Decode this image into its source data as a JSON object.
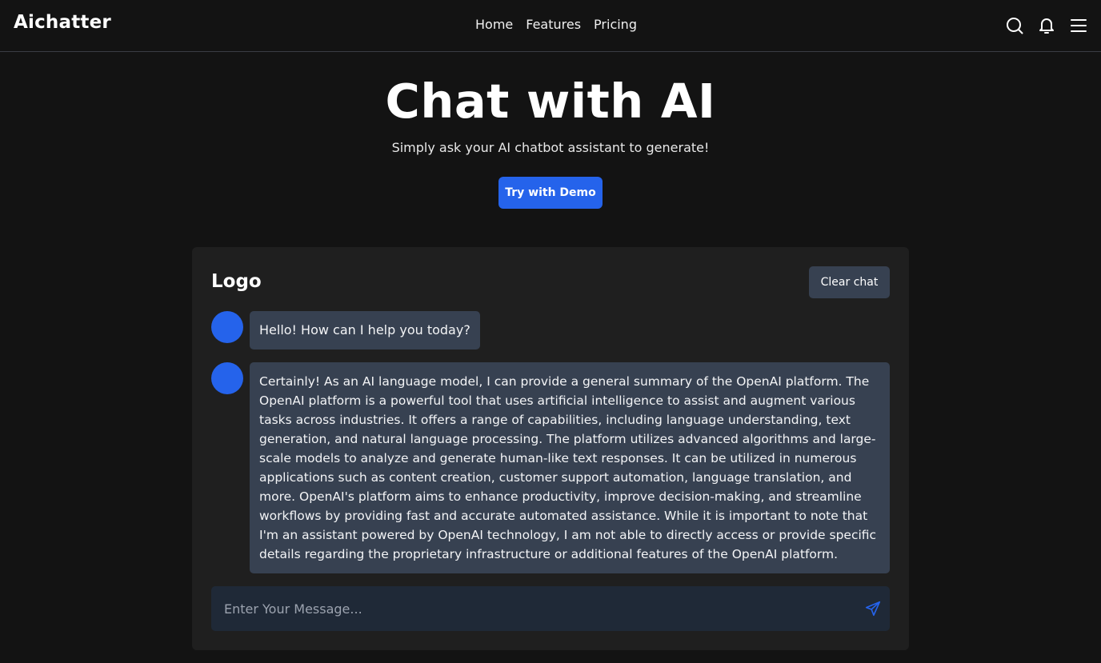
{
  "header": {
    "brand": "Aichatter",
    "nav": [
      "Home",
      "Features",
      "Pricing"
    ],
    "icons": [
      "search-icon",
      "bell-icon",
      "menu-icon"
    ]
  },
  "hero": {
    "title": "Chat with AI",
    "subtitle": "Simply ask your AI chatbot assistant to generate!",
    "cta_label": "Try with Demo"
  },
  "chat": {
    "title": "Logo",
    "clear_label": "Clear chat",
    "messages": [
      {
        "text": "Hello! How can I help you today?"
      },
      {
        "text": "Certainly! As an AI language model, I can provide a general summary of the OpenAI platform. The OpenAI platform is a powerful tool that uses artificial intelligence to assist and augment various tasks across industries. It offers a range of capabilities, including language understanding, text generation, and natural language processing. The platform utilizes advanced algorithms and large-scale models to analyze and generate human-like text responses. It can be utilized in numerous applications such as content creation, customer support automation, language translation, and more. OpenAI's platform aims to enhance productivity, improve decision-making, and streamline workflows by providing fast and accurate automated assistance. While it is important to note that I'm an assistant powered by OpenAI technology, I am not able to directly access or provide specific details regarding the proprietary infrastructure or additional features of the OpenAI platform."
      }
    ],
    "input_placeholder": "Enter Your Message...",
    "input_value": "",
    "send_icon": "send-plane-icon"
  },
  "colors": {
    "accent": "#2563eb",
    "background": "#131313",
    "panel": "#1f1f1f",
    "bubble": "#374151",
    "input": "#1f2937"
  }
}
